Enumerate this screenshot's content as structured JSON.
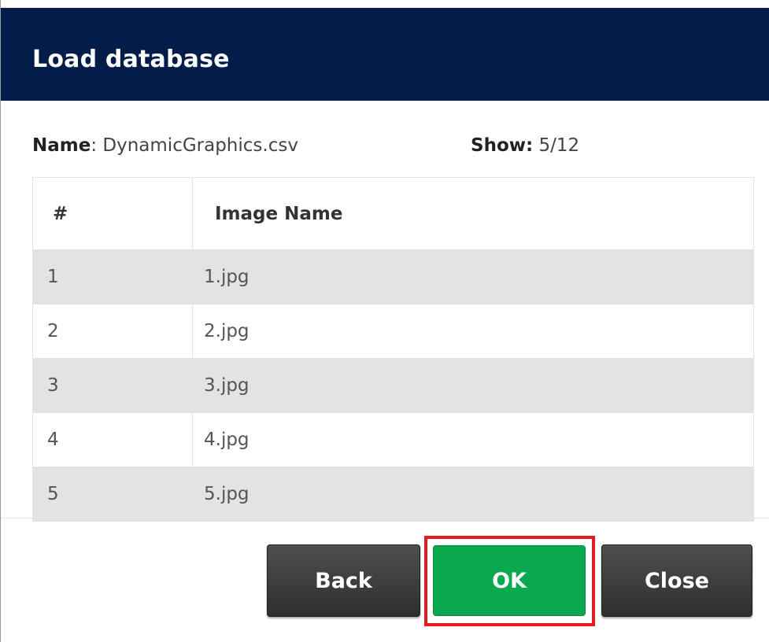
{
  "dialog": {
    "title": "Load database",
    "name_label": "Name",
    "name_value": ": DynamicGraphics.csv",
    "show_label": "Show:",
    "show_value": " 5/12"
  },
  "table": {
    "headers": [
      "#",
      "Image Name"
    ],
    "rows": [
      {
        "num": "1",
        "name": "1.jpg"
      },
      {
        "num": "2",
        "name": "2.jpg"
      },
      {
        "num": "3",
        "name": "3.jpg"
      },
      {
        "num": "4",
        "name": "4.jpg"
      },
      {
        "num": "5",
        "name": "5.jpg"
      }
    ]
  },
  "buttons": {
    "back": "Back",
    "ok": "OK",
    "close": "Close"
  },
  "colors": {
    "titlebar": "#031c4a",
    "ok_button": "#0aa84f",
    "highlight": "#e31b23",
    "dark_button": "#3a3a3a"
  }
}
